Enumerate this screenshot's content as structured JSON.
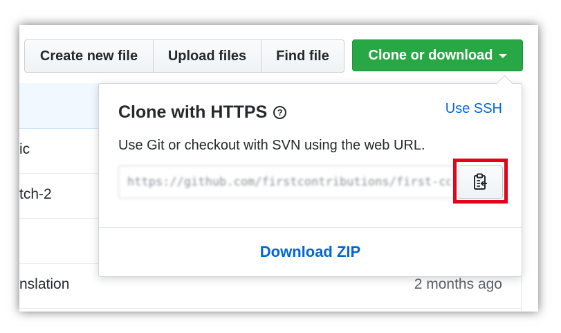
{
  "toolbar": {
    "create_new_file": "Create new file",
    "upload_files": "Upload files",
    "find_file": "Find file",
    "clone_or_download": "Clone or download"
  },
  "file_list": {
    "rows": [
      {
        "name": "ic",
        "age": ""
      },
      {
        "name": "tch-2",
        "age": ""
      },
      {
        "name": "",
        "age": ""
      },
      {
        "name": "nslation",
        "age": "2 months ago"
      }
    ]
  },
  "clone_popover": {
    "title": "Clone with HTTPS",
    "help_icon": "question-circle-icon",
    "use_ssh": "Use SSH",
    "description": "Use Git or checkout with SVN using the web URL.",
    "url_value": "https://github.com/firstcontributions/first-contributions.git",
    "copy_icon": "clipboard-icon",
    "download_zip": "Download ZIP"
  },
  "colors": {
    "clone_button": "#28a745",
    "link": "#0366d6",
    "highlight_box": "#e0051a"
  }
}
